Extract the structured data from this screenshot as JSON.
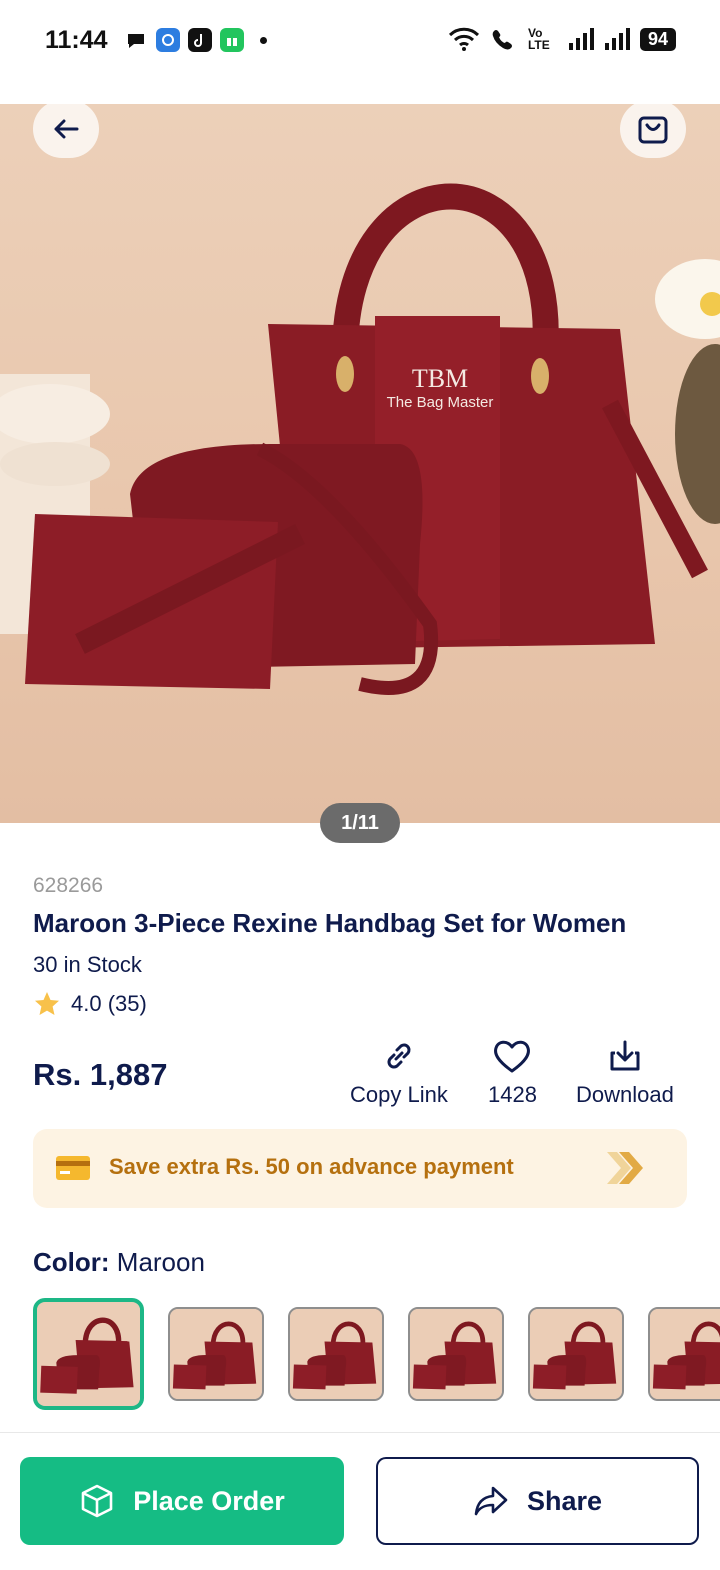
{
  "status_bar": {
    "time": "11:44",
    "network": "Vo LTE",
    "battery": "94"
  },
  "gallery": {
    "pager": "1/11",
    "brand_monogram": "TBM",
    "brand_name": "The Bag Master"
  },
  "product": {
    "sku": "628266",
    "title": "Maroon 3-Piece Rexine Handbag Set for Women",
    "stock": "30 in Stock",
    "rating": "4.0 (35)",
    "price": "Rs. 1,887"
  },
  "actions": {
    "copy_link": "Copy Link",
    "likes": "1428",
    "download": "Download"
  },
  "promo": {
    "text": "Save extra Rs. 50 on advance payment"
  },
  "color": {
    "label": "Color:",
    "value": "Maroon"
  },
  "bottom": {
    "place_order": "Place Order",
    "share": "Share"
  },
  "colors": {
    "primary": "#15bc84",
    "navy": "#0f1b4c",
    "promo_bg": "#fdf3e3",
    "promo_text": "#b5700f",
    "maroon": "#8a1c25"
  }
}
